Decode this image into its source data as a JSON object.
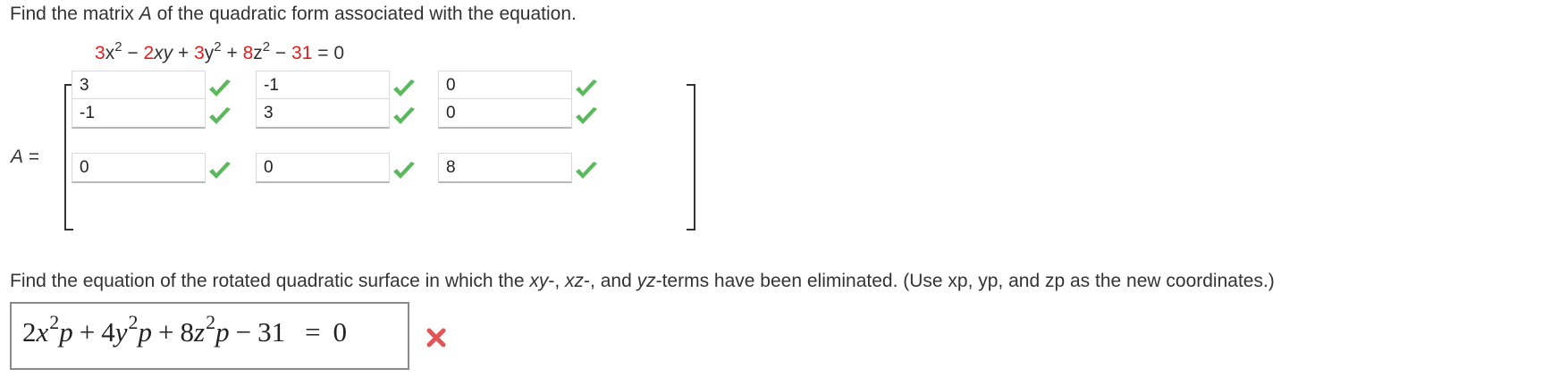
{
  "question1": {
    "prefix": "Find the matrix ",
    "var": "A",
    "suffix": " of the quadratic form associated with the equation."
  },
  "equation": {
    "c1": "3",
    "t1": "x",
    "p1": "2",
    "op1": " − ",
    "c2": "2",
    "t2": "xy",
    "op2": " + ",
    "c3": "3",
    "t3": "y",
    "p3": "2",
    "op3": " + ",
    "c4": "8",
    "t4": "z",
    "p4": "2",
    "op4": " − ",
    "c5": "31",
    "rhs": " = 0"
  },
  "matrix": {
    "label_var": "A",
    "label_eq": " =",
    "cells": [
      [
        "3",
        "-1",
        "0"
      ],
      [
        "-1",
        "3",
        "0"
      ],
      [
        "0",
        "0",
        "8"
      ]
    ],
    "all_correct": true
  },
  "question2": {
    "part1": "Find the equation of the rotated quadratic surface in which the ",
    "xy": "xy",
    "part2": "-, ",
    "xz": "xz",
    "part3": "-, and ",
    "yz": "yz",
    "part4": "-terms have been eliminated. (Use xp, yp, and zp as the new coordinates.)"
  },
  "answer": {
    "c1": "2",
    "v1": "x",
    "e1": "2",
    "s1": "p",
    "op1": "+",
    "c2": "4",
    "v2": "y",
    "e2": "2",
    "s2": "p",
    "op2": "+",
    "c3": "8",
    "v3": "z",
    "e3": "2",
    "s3": "p",
    "op3": "−",
    "const": "31",
    "eq": "=",
    "rhs": "0",
    "status": "incorrect"
  },
  "colors": {
    "coefficient": "#e31e1e",
    "check": "#5cb85c",
    "cross": "#e05555"
  },
  "icons": {
    "correct": "checkmark-icon",
    "incorrect": "cross-icon"
  }
}
